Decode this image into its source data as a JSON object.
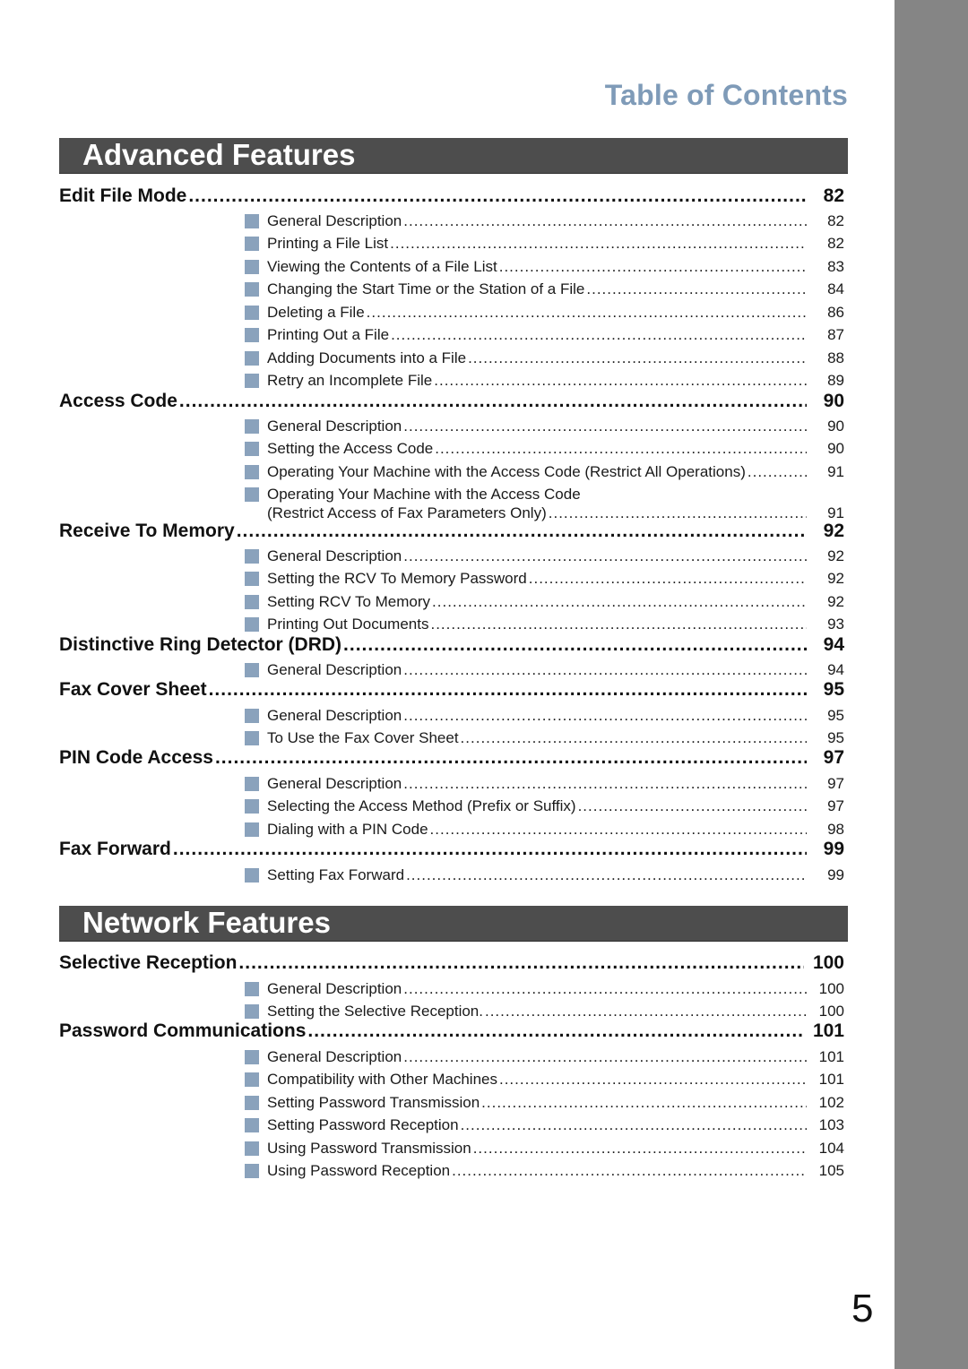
{
  "page_title": "Table of Contents",
  "page_number": "5",
  "bullet_color": "#8aa2bc",
  "sections": [
    {
      "title": "Advanced Features",
      "entries": [
        {
          "label": "Edit File Mode",
          "page": "82",
          "items": [
            {
              "label": "General Description",
              "page": "82"
            },
            {
              "label": "Printing a File List",
              "page": "82"
            },
            {
              "label": "Viewing the Contents of a File List",
              "page": "83"
            },
            {
              "label": "Changing the Start Time or the Station of a File",
              "page": "84"
            },
            {
              "label": "Deleting a File",
              "page": "86"
            },
            {
              "label": "Printing Out a File",
              "page": "87"
            },
            {
              "label": "Adding Documents into a File",
              "page": "88"
            },
            {
              "label": "Retry an Incomplete File",
              "page": "89"
            }
          ]
        },
        {
          "label": "Access Code",
          "page": "90",
          "items": [
            {
              "label": "General Description",
              "page": "90"
            },
            {
              "label": "Setting the Access Code",
              "page": "90"
            },
            {
              "label": "Operating Your Machine with the Access Code (Restrict All Operations)",
              "page": "91"
            },
            {
              "label": "Operating Your Machine with the Access Code",
              "label_line2": "(Restrict Access of Fax Parameters Only)",
              "page": "91"
            }
          ]
        },
        {
          "label": "Receive To Memory",
          "page": "92",
          "items": [
            {
              "label": "General Description",
              "page": "92"
            },
            {
              "label": "Setting the RCV To Memory Password",
              "page": "92"
            },
            {
              "label": "Setting RCV To Memory",
              "page": "92"
            },
            {
              "label": "Printing Out Documents",
              "page": "93"
            }
          ]
        },
        {
          "label": "Distinctive Ring Detector (DRD)",
          "page": "94",
          "items": [
            {
              "label": "General Description",
              "page": "94"
            }
          ]
        },
        {
          "label": "Fax Cover Sheet",
          "page": "95",
          "items": [
            {
              "label": "General Description",
              "page": "95"
            },
            {
              "label": "To Use the Fax Cover Sheet",
              "page": "95"
            }
          ]
        },
        {
          "label": "PIN Code Access",
          "page": "97",
          "items": [
            {
              "label": "General Description",
              "page": "97"
            },
            {
              "label": "Selecting the Access Method (Prefix or Suffix)",
              "page": "97"
            },
            {
              "label": "Dialing with a PIN Code",
              "page": "98"
            }
          ]
        },
        {
          "label": "Fax Forward",
          "page": "99",
          "items": [
            {
              "label": "Setting Fax Forward",
              "page": "99"
            }
          ]
        }
      ]
    },
    {
      "title": "Network Features",
      "entries": [
        {
          "label": "Selective Reception",
          "page": "100",
          "items": [
            {
              "label": "General Description",
              "page": "100"
            },
            {
              "label": "Setting the Selective Reception.",
              "page": "100"
            }
          ]
        },
        {
          "label": "Password Communications",
          "page": "101",
          "items": [
            {
              "label": "General Description",
              "page": "101"
            },
            {
              "label": "Compatibility with Other Machines",
              "page": "101"
            },
            {
              "label": "Setting Password Transmission",
              "page": "102"
            },
            {
              "label": "Setting Password Reception",
              "page": "103"
            },
            {
              "label": "Using Password Transmission",
              "page": "104"
            },
            {
              "label": "Using Password Reception",
              "page": "105"
            }
          ]
        }
      ]
    }
  ]
}
